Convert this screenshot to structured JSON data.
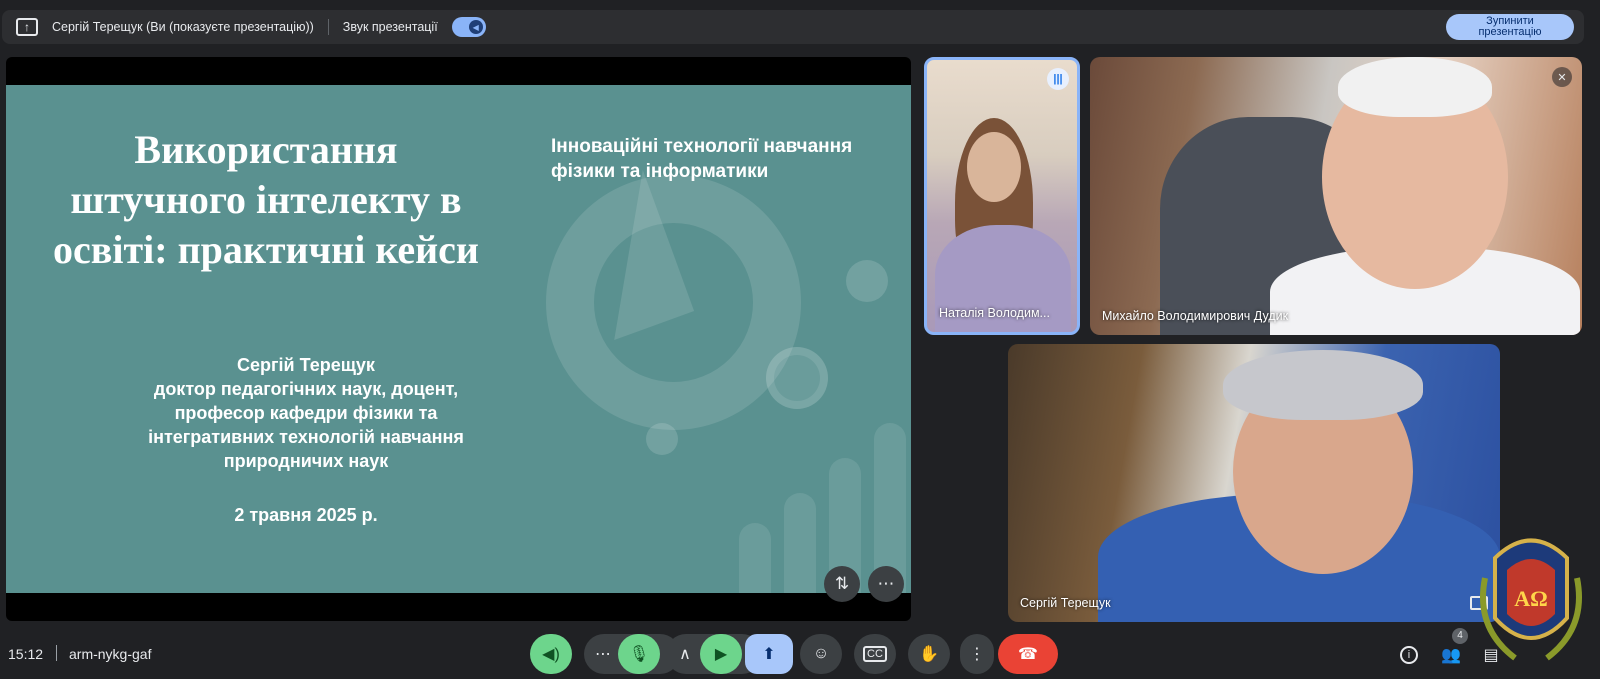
{
  "topbar": {
    "presenter_text": "Сергій Терещук (Ви (показуєте презентацію))",
    "audio_label": "Звук презентації",
    "stop_button": "Зупинити презентацію"
  },
  "slide": {
    "title": "Використання штучного інтелекту в освіті: практичні кейси",
    "subtitle": "Інноваційні технології навчання фізики та інформатики",
    "author_lines": [
      "Сергій Терещук",
      "доктор педагогічних наук, доцент,",
      "професор кафедри фізики та",
      "інтегративних технологій навчання",
      "природничих наук"
    ],
    "date": "2 травня 2025 р."
  },
  "participants": [
    {
      "name": "Наталія Володим...",
      "status": "speaking"
    },
    {
      "name": "Михайло Володимирович Дудик",
      "status": "muted"
    },
    {
      "name": "Сергій Терещук",
      "status": "self"
    }
  ],
  "bottombar": {
    "time": "15:12",
    "meeting_code": "arm-nykg-gaf",
    "participant_count": "4",
    "logo_letters": "AΩ"
  },
  "colors": {
    "slide_bg": "#5a9190",
    "accent_blue": "#a8c7fa",
    "mic_green": "#6dd58c",
    "end_call_red": "#ea4335"
  }
}
